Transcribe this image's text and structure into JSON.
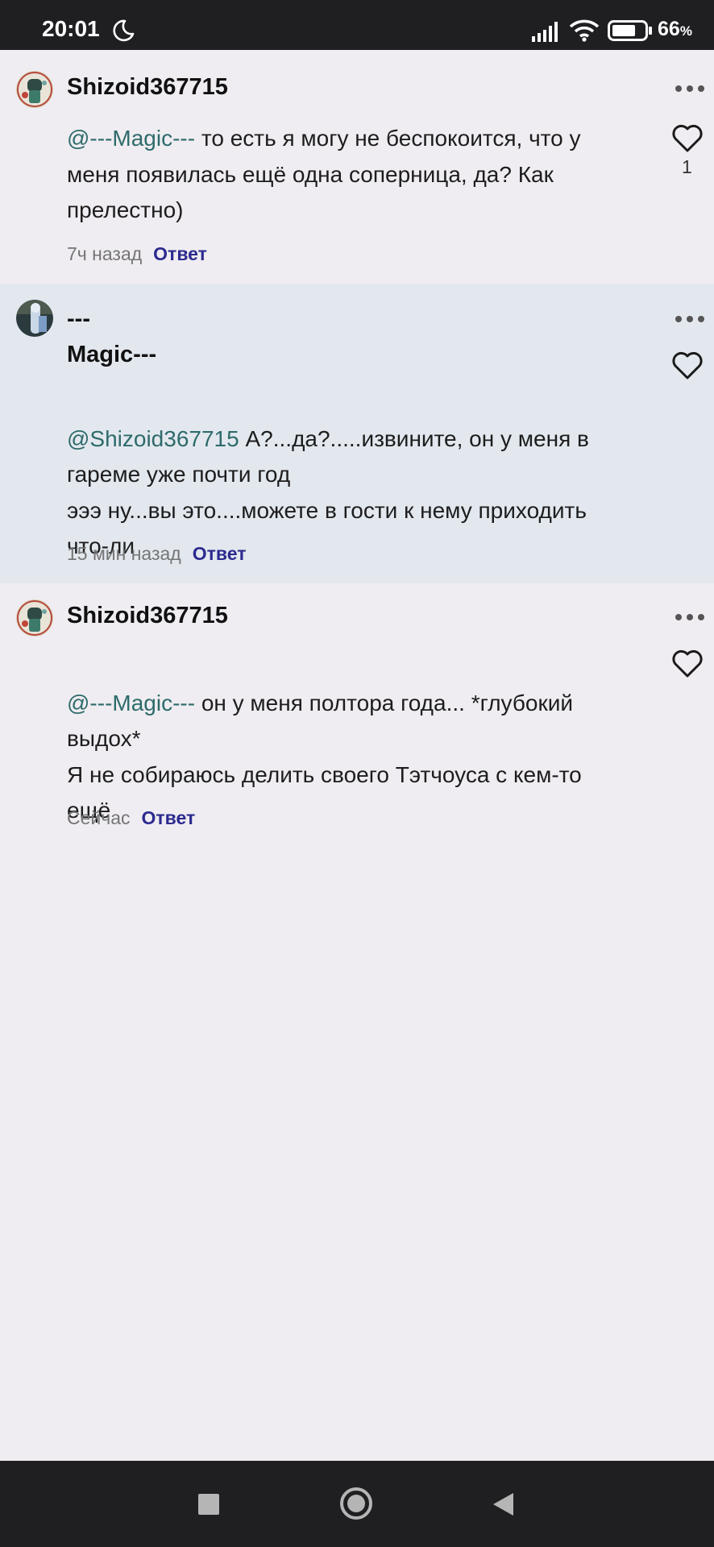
{
  "status_bar": {
    "time": "20:01",
    "battery_value": "66",
    "battery_unit": "%"
  },
  "comments": [
    {
      "username": "Shizoid367715",
      "mention": "@---Magic---",
      "text": " то есть я могу не беспокоится, что у меня появилась ещё одна соперница, да? Как прелестно)",
      "time": "7ч назад",
      "reply": "Ответ",
      "likes": "1"
    },
    {
      "username_line1": "---",
      "username_line2": "Magic---",
      "mention": "@Shizoid367715",
      "text": " А?...да?.....извините, он у меня в гареме уже почти год\nэээ ну...вы это....можете в гости к нему приходить что-ли",
      "time": "15 мин назад",
      "reply": "Ответ"
    },
    {
      "username": "Shizoid367715",
      "mention": "@---Magic---",
      "text": " он у меня полтора года... *глубокий выдох*\nЯ не собираюсь делить своего Тэтчоуса с кем-то ещё",
      "time": "Сейчас",
      "reply": "Ответ"
    }
  ],
  "icons": {
    "more": "more-horizontal-icon",
    "like": "heart-outline-icon",
    "moon": "do-not-disturb-moon-icon",
    "signal": "cellular-signal-icon",
    "wifi": "wifi-icon",
    "battery": "battery-icon",
    "nav_recents": "square-icon",
    "nav_home": "circle-icon",
    "nav_back": "triangle-back-icon"
  },
  "colors": {
    "background": "#efedf1",
    "highlight": "#e3e8ef",
    "mention": "#2f6b6b",
    "reply_link": "#2c2a8e",
    "bars": "#1f1e21"
  }
}
